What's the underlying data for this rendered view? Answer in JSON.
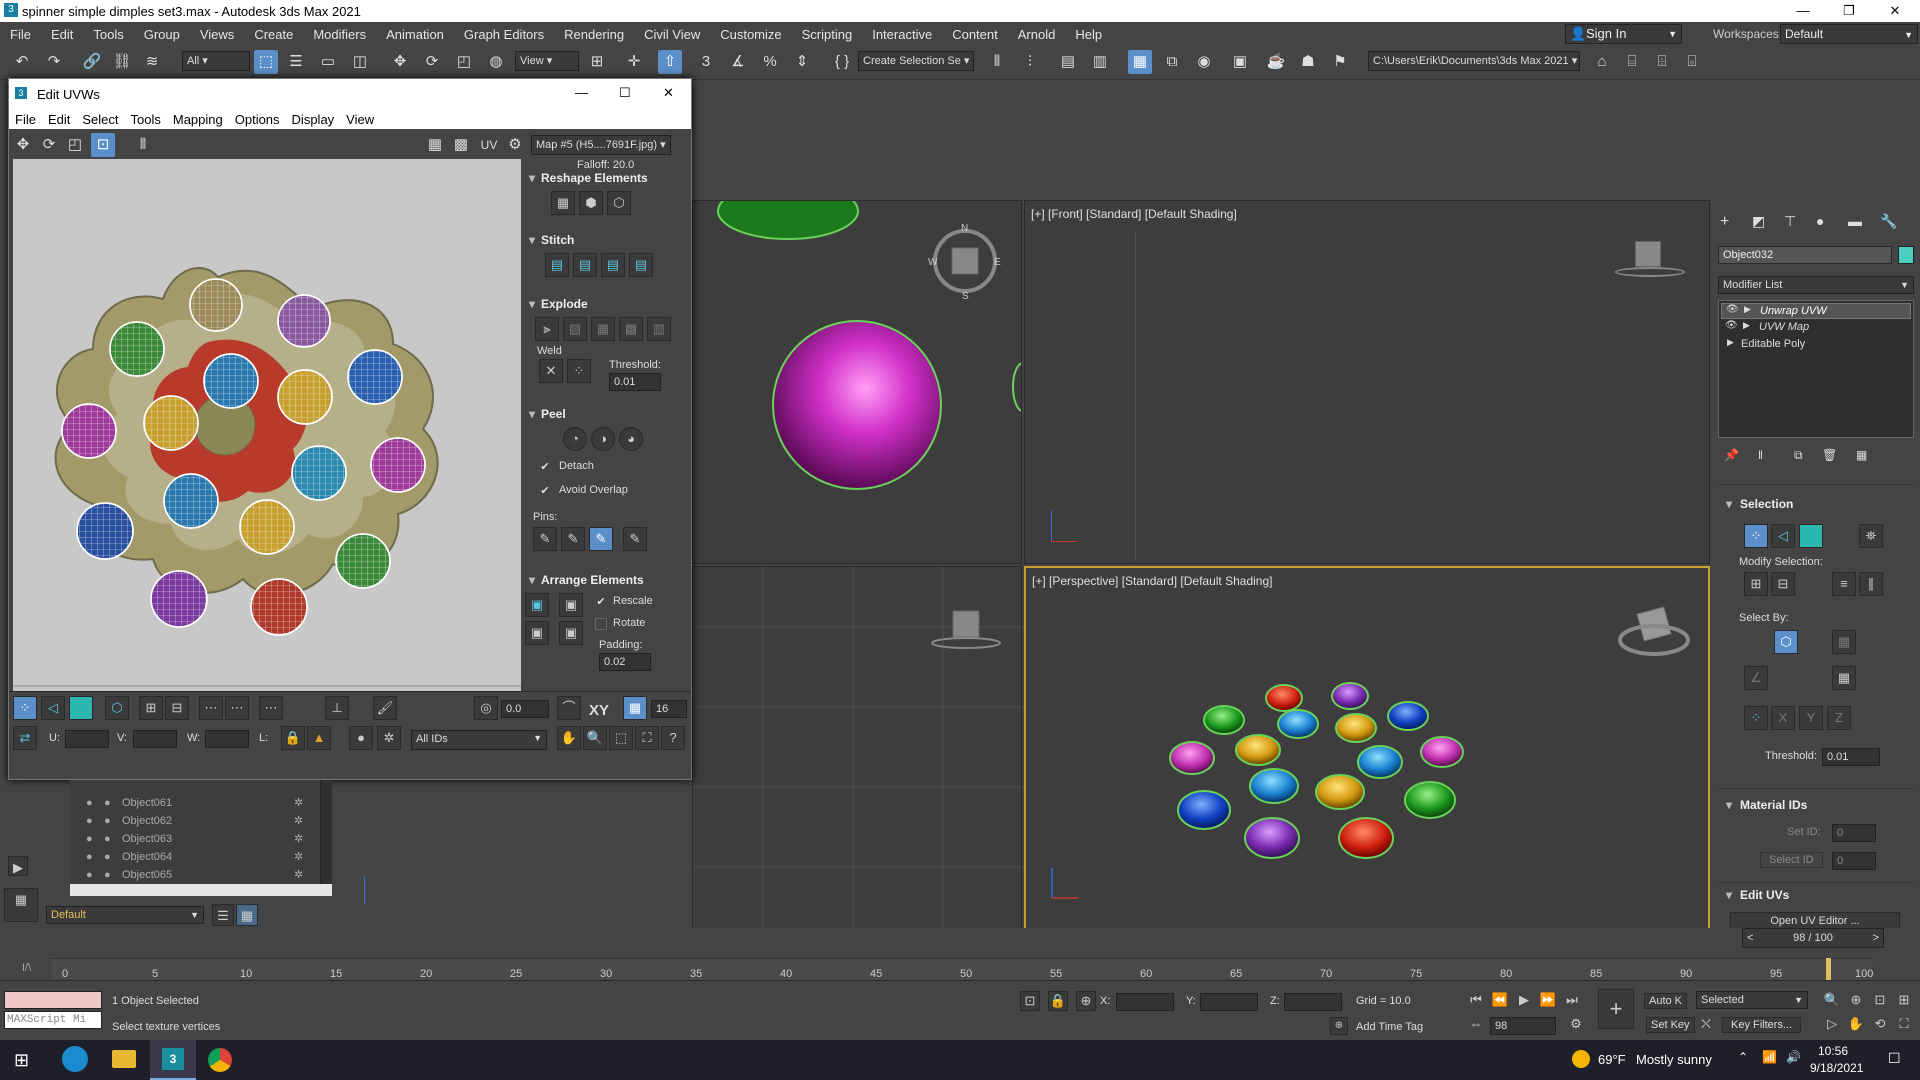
{
  "app": {
    "title": "spinner simple dimples set3.max - Autodesk 3ds Max 2021",
    "menu": [
      "File",
      "Edit",
      "Tools",
      "Group",
      "Views",
      "Create",
      "Modifiers",
      "Animation",
      "Graph Editors",
      "Rendering",
      "Civil View",
      "Customize",
      "Scripting",
      "Interactive",
      "Content",
      "Arnold",
      "Help"
    ],
    "sign_in": "Sign In",
    "workspaces_label": "Workspaces:",
    "workspace": "Default"
  },
  "toolbar": {
    "filter": "All",
    "ref_coord": "View",
    "selection_set": "Create Selection Se",
    "project_path": "C:\\Users\\Erik\\Documents\\3ds Max 2021"
  },
  "uvw": {
    "title": "Edit UVWs",
    "menu": [
      "File",
      "Edit",
      "Select",
      "Tools",
      "Mapping",
      "Options",
      "Display",
      "View"
    ],
    "uv_label": "UV",
    "map_select": "Map #5 (H5....7691F.jpg)",
    "falloff": "Falloff: 20.0",
    "reshape": "Reshape Elements",
    "stitch": "Stitch",
    "explode": "Explode",
    "weld": "Weld",
    "threshold_label": "Threshold:",
    "threshold": "0.01",
    "peel": "Peel",
    "detach": "Detach",
    "avoid_overlap": "Avoid Overlap",
    "pins": "Pins:",
    "arrange": "Arrange Elements",
    "rescale": "Rescale",
    "rotate": "Rotate",
    "padding_label": "Padding:",
    "padding": "0.02",
    "rotate_val": "0.0",
    "xy": "XY",
    "grid_val": "16",
    "u_label": "U:",
    "v_label": "V:",
    "w_label": "W:",
    "l_label": "L:",
    "ids": "All IDs"
  },
  "viewports": {
    "front": "[+] [Front] [Standard] [Default Shading]",
    "perspective": "[+] [Perspective] [Standard] [Default Shading]"
  },
  "command_panel": {
    "object_name": "Object032",
    "modifier_list": "Modifier List",
    "stack": [
      "Unwrap UVW",
      "UVW Map",
      "Editable Poly"
    ],
    "selection": "Selection",
    "modify_selection": "Modify Selection:",
    "select_by": "Select By:",
    "threshold_label": "Threshold:",
    "threshold": "0.01",
    "material_ids": "Material IDs",
    "set_id": "Set ID:",
    "select_id": "Select ID",
    "edit_uvs": "Edit UVs",
    "open_uv_editor": "Open UV Editor ...",
    "frame_counter": "98 / 100",
    "id_val": "0"
  },
  "explorer": {
    "rows": [
      "Object061",
      "Object062",
      "Object063",
      "Object064",
      "Object065"
    ],
    "layer": "Default"
  },
  "timeline": {
    "ticks": [
      "0",
      "5",
      "10",
      "15",
      "20",
      "25",
      "30",
      "35",
      "40",
      "45",
      "50",
      "55",
      "60",
      "65",
      "70",
      "75",
      "80",
      "85",
      "90",
      "95",
      "100"
    ],
    "current_frame": 98
  },
  "status": {
    "objects_selected": "1 Object Selected",
    "prompt": "Select texture vertices",
    "maxscript": "MAXScript Mi",
    "x_label": "X:",
    "y_label": "Y:",
    "z_label": "Z:",
    "grid": "Grid = 10.0",
    "add_time_tag": "Add Time Tag",
    "auto_key": "Auto K",
    "set_key": "Set Key",
    "selected": "Selected",
    "key_filters": "Key Filters...",
    "frame": "98"
  },
  "taskbar": {
    "temperature": "69°F",
    "weather": "Mostly sunny",
    "time": "10:56",
    "date": "9/18/2021"
  },
  "colors": {
    "accent": "#5b8fc9",
    "viewport_bg": "#3d3d3d",
    "panel_bg": "#444444",
    "active_border": "#c8a032"
  }
}
